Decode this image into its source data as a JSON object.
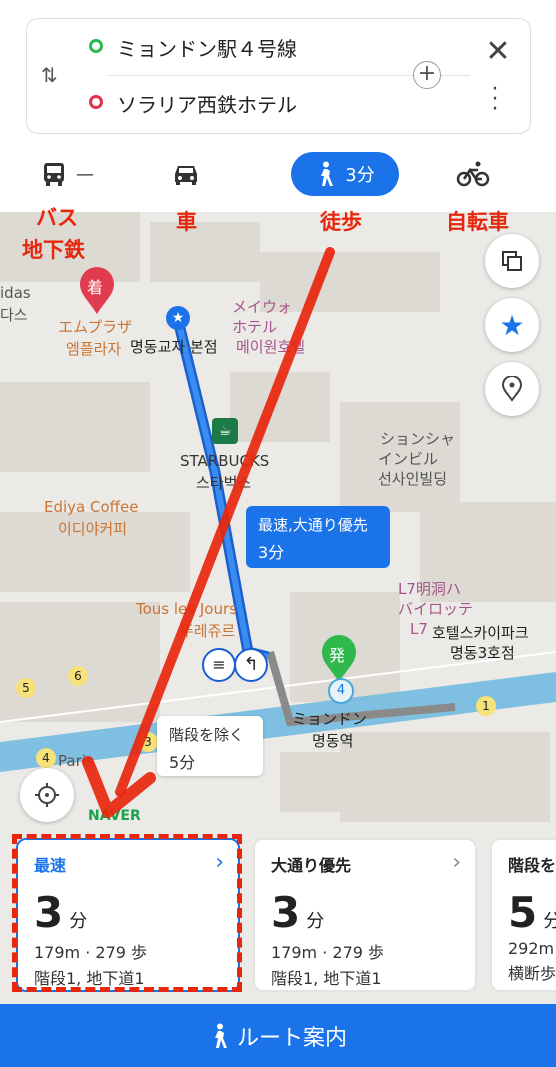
{
  "route": {
    "origin": "ミョンドン駅４号線",
    "destination": "ソラリア西鉄ホテル"
  },
  "modes": [
    {
      "name": "bus",
      "value": "—",
      "annotation": "バス\n地下鉄"
    },
    {
      "name": "car",
      "value": "",
      "annotation": "車"
    },
    {
      "name": "walk",
      "value": "3分",
      "annotation": "徒歩"
    },
    {
      "name": "bike",
      "value": "",
      "annotation": "自転車"
    }
  ],
  "annotations": {
    "bus": "バス",
    "subway": "地下鉄",
    "car": "車",
    "walk": "徒歩",
    "bike": "自転車"
  },
  "map": {
    "pin_arrival": "着",
    "pin_departure": "発",
    "pois": {
      "emplaza_jp": "エムプラザ",
      "emplaza_kr": "엠플라자",
      "myeongdong_kyoja": "명동교자 본점",
      "mayway_jp1": "メイウォ",
      "mayway_jp2": "ホテル",
      "mayway_kr": "메이원호텔",
      "starbucks_en": "STARBUCKS",
      "starbucks_kr": "스타벅스",
      "shinsun_jp1": "ションシャ",
      "shinsun_jp2": "インビル",
      "shinsun_kr": "선사인빌딩",
      "ediya_en": "Ediya Coffee",
      "ediya_kr": "이디야커피",
      "tous_en": "Tous les Jours",
      "tous_kr": "뚜레쥬르",
      "l7_jp1": "L7明洞ハ",
      "l7_jp2": "バイロッテ",
      "l7_jp3": "L7",
      "skypark_kr1": "호텔스카이파크",
      "skypark_kr2": "명동3호점",
      "station_jp": "ミョンドン",
      "station_kr": "명동역",
      "adidas": "idas",
      "adidas_kr": "다스",
      "paris": "Paris",
      "naver": "NAVER"
    },
    "bubble_fastest": {
      "line1": "最速,大通り優先",
      "line2": "3分"
    },
    "bubble_stairs": {
      "line1": "階段を除く",
      "line2": "5分"
    }
  },
  "cards": [
    {
      "title": "最速",
      "time": "3",
      "unit": "分",
      "distance": "179m · 279 歩",
      "details": "階段1, 地下道1",
      "highlighted": true
    },
    {
      "title": "大通り優先",
      "time": "3",
      "unit": "分",
      "distance": "179m · 279 歩",
      "details": "階段1, 地下道1",
      "highlighted": false
    },
    {
      "title": "階段を",
      "time": "5",
      "unit": "分",
      "distance": "292m",
      "details": "横断歩",
      "highlighted": false
    }
  ],
  "bottom_button": "ルート案内",
  "colors": {
    "accent": "#1a73e8",
    "annotation_red": "#e8260d",
    "route_blue": "#1a73e8",
    "subway_line": "#4aa8d8"
  }
}
